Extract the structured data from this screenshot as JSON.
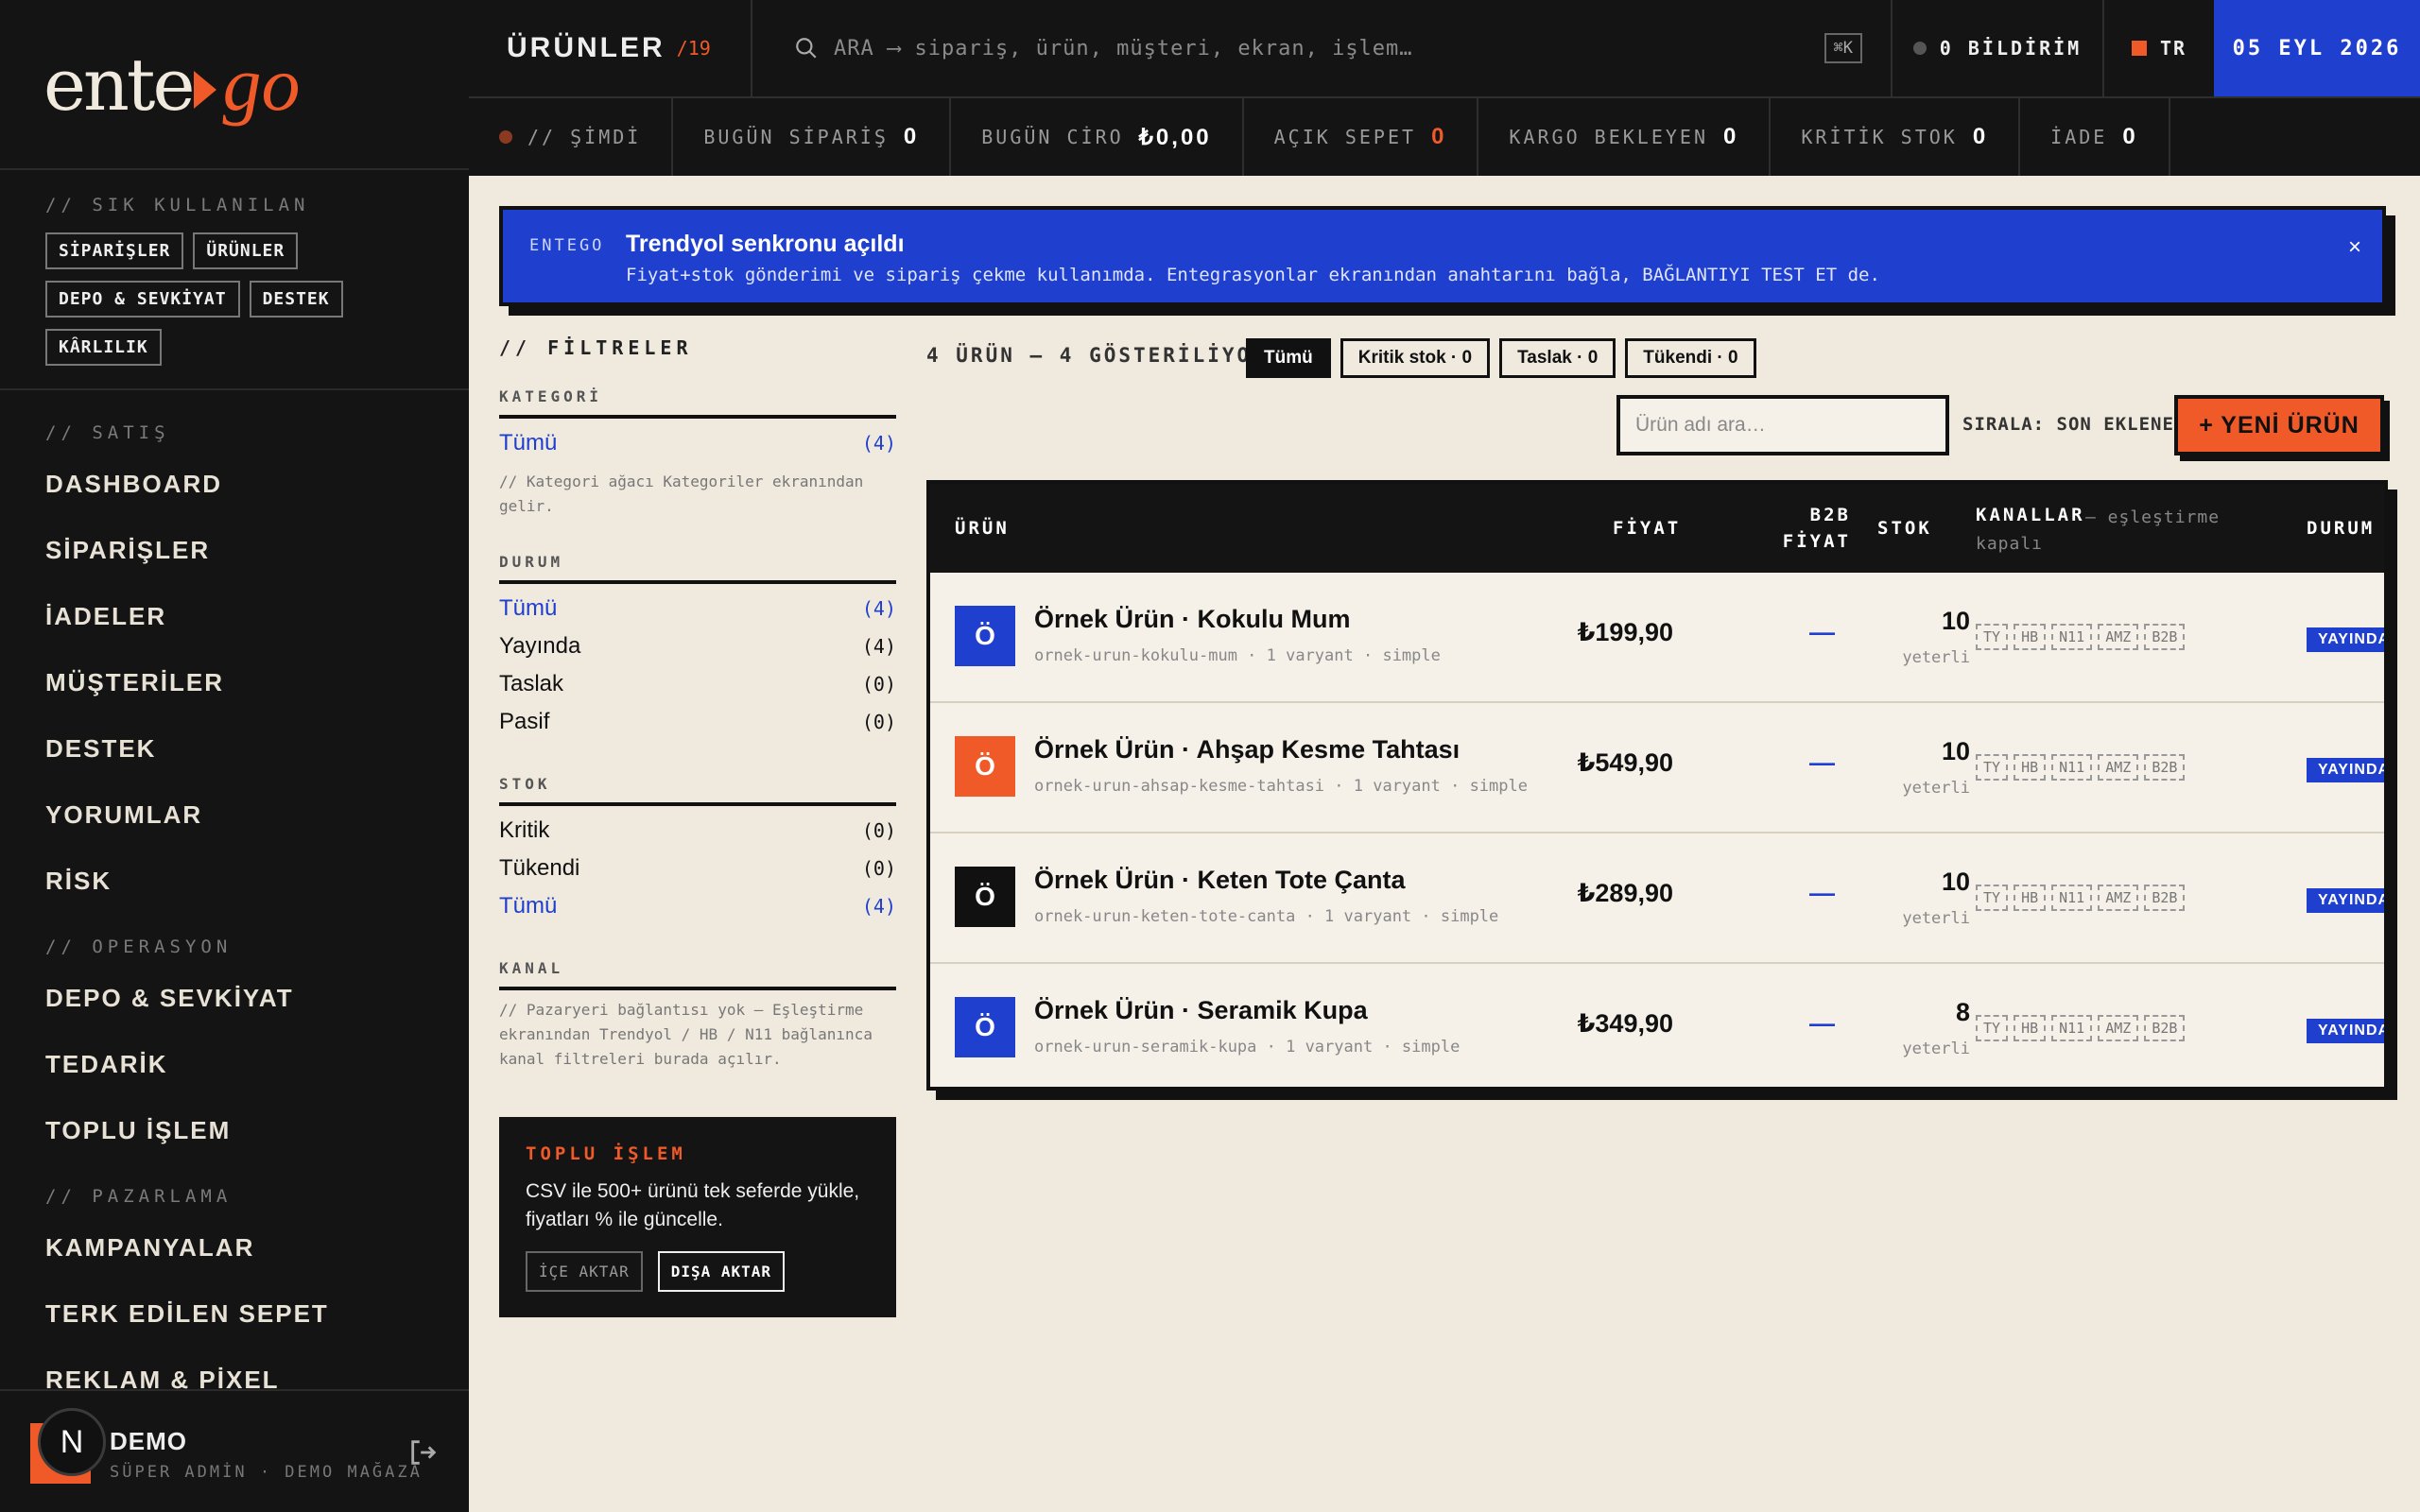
{
  "logo": {
    "part1": "ente",
    "part2": "go"
  },
  "sidebar": {
    "favorites_label": "// SIK KULLANILAN",
    "favorites": [
      "SİPARİŞLER",
      "ÜRÜNLER",
      "DEPO & SEVKİYAT",
      "DESTEK",
      "KÂRLILIK"
    ],
    "groups": [
      {
        "label": "// SATIŞ",
        "items": [
          "DASHBOARD",
          "SİPARİŞLER",
          "İADELER",
          "MÜŞTERİLER",
          "DESTEK",
          "YORUMLAR",
          "RİSK"
        ]
      },
      {
        "label": "// OPERASYON",
        "items": [
          "DEPO & SEVKİYAT",
          "TEDARİK",
          "TOPLU İŞLEM"
        ]
      },
      {
        "label": "// PAZARLAMA",
        "items": [
          "KAMPANYALAR",
          "TERK EDİLEN SEPET",
          "REKLAM & PİXEL"
        ]
      }
    ],
    "user": {
      "avatar": "N",
      "name": "DEMO",
      "role": "SÜPER ADMİN · DEMO MAĞAZA"
    }
  },
  "header": {
    "title": "ÜRÜNLER",
    "count": "/19",
    "search_placeholder": "ARA ⟶ sipariş, ürün, müşteri, ekran, işlem…",
    "shortcut": "⌘K",
    "notifications": "0 BİLDİRİM",
    "lang": "TR",
    "date": "05 EYL 2026"
  },
  "stats": [
    {
      "label": "// ŞİMDİ",
      "value": ""
    },
    {
      "label": "BUGÜN SİPARİŞ",
      "value": "0"
    },
    {
      "label": "BUGÜN CİRO",
      "value": "₺0,00"
    },
    {
      "label": "AÇIK SEPET",
      "value": "0"
    },
    {
      "label": "KARGO BEKLEYEN",
      "value": "0"
    },
    {
      "label": "KRİTİK STOK",
      "value": "0"
    },
    {
      "label": "İADE",
      "value": "0"
    }
  ],
  "banner": {
    "tag": "ENTEGO",
    "title": "Trendyol senkronu açıldı",
    "text": "Fiyat+stok gönderimi ve sipariş çekme kullanımda. Entegrasyonlar ekranından anahtarını bağla, BAĞLANTIYI TEST ET de.",
    "close": "×"
  },
  "filters": {
    "title": "// FİLTRELER",
    "kategori": {
      "label": "KATEGORİ",
      "all": "Tümü",
      "all_count": "(4)",
      "note": "// Kategori ağacı Kategoriler ekranından gelir."
    },
    "durum": {
      "label": "DURUM",
      "rows": [
        {
          "name": "Tümü",
          "count": "(4)"
        },
        {
          "name": "Yayında",
          "count": "(4)"
        },
        {
          "name": "Taslak",
          "count": "(0)"
        },
        {
          "name": "Pasif",
          "count": "(0)"
        }
      ]
    },
    "stok": {
      "label": "STOK",
      "rows": [
        {
          "name": "Kritik",
          "count": "(0)"
        },
        {
          "name": "Tükendi",
          "count": "(0)"
        },
        {
          "name": "Tümü",
          "count": "(4)"
        }
      ]
    },
    "kanal": {
      "label": "KANAL",
      "note": "// Pazaryeri bağlantısı yok — Eşleştirme ekranından Trendyol / HB / N11 bağlanınca kanal filtreleri burada açılır."
    }
  },
  "bulk": {
    "title": "TOPLU İŞLEM",
    "text": "CSV ile 500+ ürünü tek seferde yükle, fiyatları % ile güncelle.",
    "import": "İÇE AKTAR",
    "export": "DIŞA AKTAR"
  },
  "list": {
    "summary": "4 ÜRÜN — 4 GÖSTERİLİYOR",
    "tabs": [
      "Tümü",
      "Kritik stok · 0",
      "Taslak · 0",
      "Tükendi · 0"
    ],
    "search_placeholder": "Ürün adı ara…",
    "sort": "SIRALA: SON EKLENEN",
    "new_button": "+ YENİ ÜRÜN"
  },
  "table": {
    "headers": {
      "product": "ÜRÜN",
      "price": "FİYAT",
      "b2b1": "B2B",
      "b2b2": "FİYAT",
      "stock": "STOK",
      "channels": "KANALLAR",
      "channels_note": "— eşleştirme kapalı",
      "status": "DURUM"
    },
    "rows": [
      {
        "thumb": "Ö",
        "thumb_color": "#1f3fce",
        "name": "Örnek Ürün · Kokulu Mum",
        "meta": "ornek-urun-kokulu-mum · 1 varyant · simple",
        "price": "₺199,90",
        "b2b": "—",
        "stock": "10",
        "stock_label": "yeterli",
        "status": "YAYINDA"
      },
      {
        "thumb": "Ö",
        "thumb_color": "#f05a28",
        "name": "Örnek Ürün · Ahşap Kesme Tahtası",
        "meta": "ornek-urun-ahsap-kesme-tahtasi · 1 varyant · simple",
        "price": "₺549,90",
        "b2b": "—",
        "stock": "10",
        "stock_label": "yeterli",
        "status": "YAYINDA"
      },
      {
        "thumb": "Ö",
        "thumb_color": "#111111",
        "name": "Örnek Ürün · Keten Tote Çanta",
        "meta": "ornek-urun-keten-tote-canta · 1 varyant · simple",
        "price": "₺289,90",
        "b2b": "—",
        "stock": "10",
        "stock_label": "yeterli",
        "status": "YAYINDA"
      },
      {
        "thumb": "Ö",
        "thumb_color": "#1f3fce",
        "name": "Örnek Ürün · Seramik Kupa",
        "meta": "ornek-urun-seramik-kupa · 1 varyant · simple",
        "price": "₺349,90",
        "b2b": "—",
        "stock": "8",
        "stock_label": "yeterli",
        "status": "YAYINDA"
      }
    ],
    "channels": [
      "TY",
      "HB",
      "N11",
      "AMZ",
      "B2B"
    ]
  }
}
